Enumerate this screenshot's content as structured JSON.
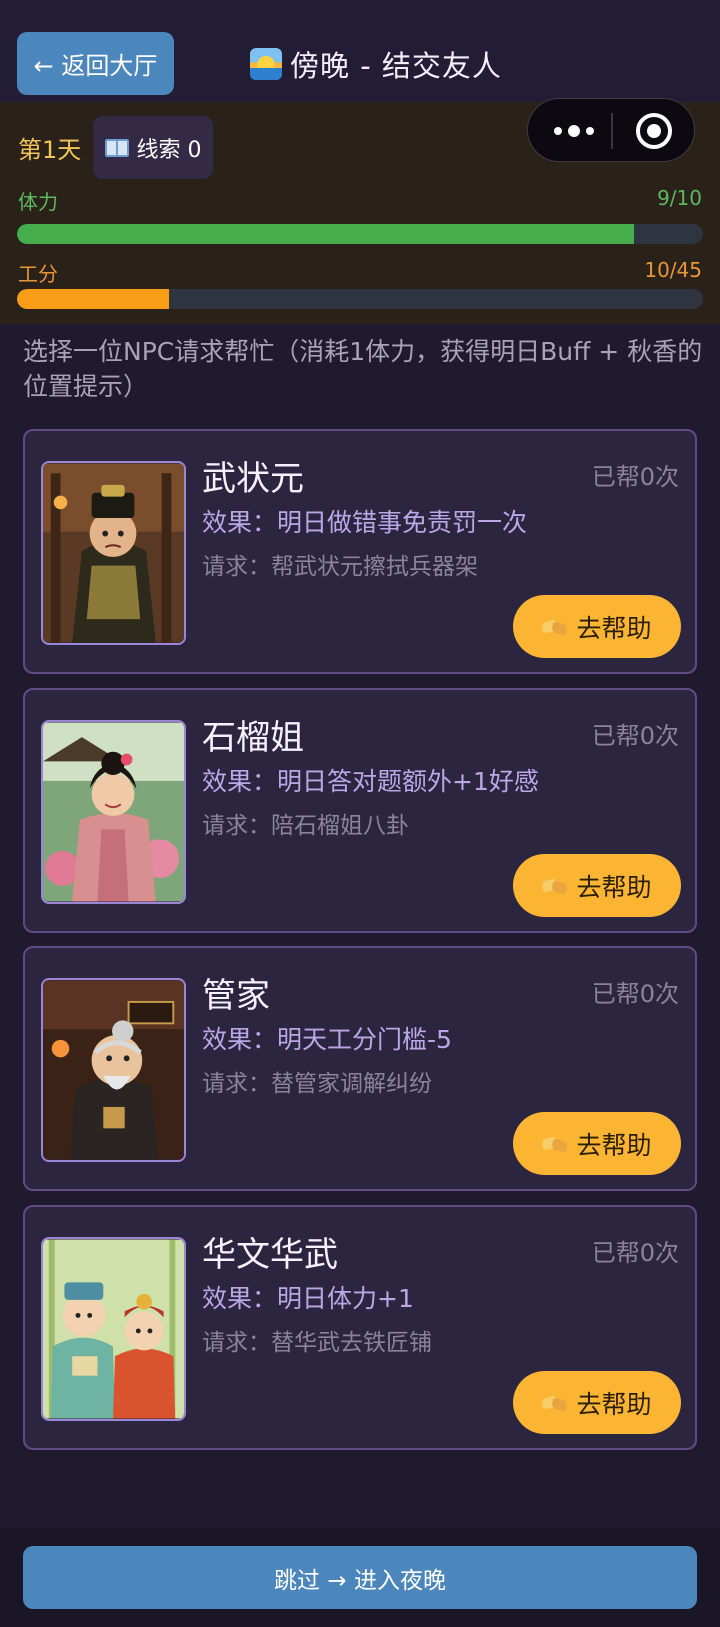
{
  "header": {
    "back_label": "← 返回大厅",
    "title": "傍晚 - 结交友人",
    "title_icon": "sunset-icon"
  },
  "status": {
    "day": "第1天",
    "clue_label": "线索 0",
    "stamina": {
      "label": "体力",
      "value": "9/10",
      "fraction": 0.9,
      "color": "#46ad4c",
      "label_color": "#5fb65f"
    },
    "work": {
      "label": "工分",
      "value": "10/45",
      "fraction": 0.222,
      "color": "#f99e16",
      "label_color": "#e8963a"
    }
  },
  "miniprogram_capsule": {
    "more_icon": "more-icon",
    "close_icon": "target-icon"
  },
  "instruction": "选择一位NPC请求帮忙（消耗1体力，获得明日Buff + 秋香的位置提示）",
  "npcs": [
    {
      "name": "武状元",
      "helped": "已帮0次",
      "effect": "效果：明日做错事免责罚一次",
      "request": "请求：帮武状元擦拭兵器架",
      "button": "去帮助",
      "portrait": "warrior"
    },
    {
      "name": "石榴姐",
      "helped": "已帮0次",
      "effect": "效果：明日答对题额外+1好感",
      "request": "请求：陪石榴姐八卦",
      "button": "去帮助",
      "portrait": "lady"
    },
    {
      "name": "管家",
      "helped": "已帮0次",
      "effect": "效果：明天工分门槛-5",
      "request": "请求：替管家调解纠纷",
      "button": "去帮助",
      "portrait": "butler"
    },
    {
      "name": "华文华武",
      "helped": "已帮0次",
      "effect": "效果：明日体力+1",
      "request": "请求：替华武去铁匠铺",
      "button": "去帮助",
      "portrait": "twins"
    }
  ],
  "footer": {
    "skip_label": "跳过 → 进入夜晚"
  },
  "colors": {
    "accent_blue": "#4b86bd",
    "accent_yellow": "#fcb533",
    "card_bg": "#2c2540",
    "card_border": "#5d4d86"
  }
}
